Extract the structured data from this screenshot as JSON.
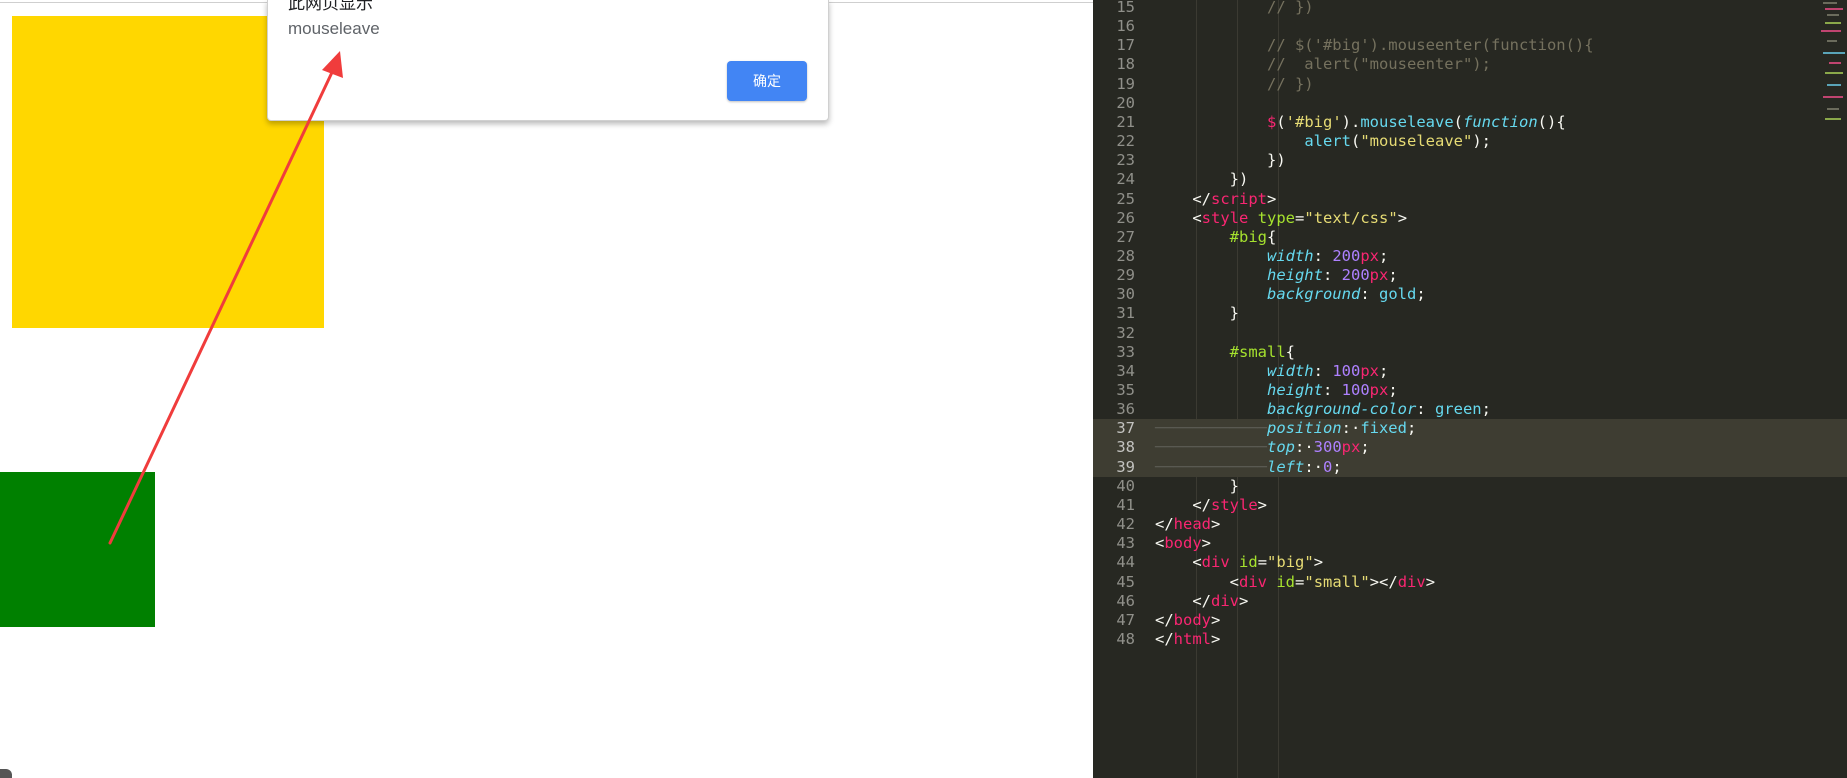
{
  "browser": {
    "dialog": {
      "title": "此网页显示",
      "message": "mouseleave",
      "ok_label": "确定"
    },
    "boxes": {
      "big_color": "#ffd700",
      "small_color": "#008000"
    },
    "arrow_color": "#f03c3c"
  },
  "editor": {
    "theme": {
      "background": "#272822",
      "gutter_text": "#90908a"
    },
    "lines": [
      {
        "n": "15",
        "tokens": [
          [
            "            ",
            "plain"
          ],
          [
            "// })",
            "com"
          ]
        ]
      },
      {
        "n": "16",
        "tokens": []
      },
      {
        "n": "17",
        "tokens": [
          [
            "            ",
            "plain"
          ],
          [
            "// $('#big').mouseenter(function(){",
            "com"
          ]
        ]
      },
      {
        "n": "18",
        "tokens": [
          [
            "            ",
            "plain"
          ],
          [
            "//  alert(\"mouseenter\");",
            "com"
          ]
        ]
      },
      {
        "n": "19",
        "tokens": [
          [
            "            ",
            "plain"
          ],
          [
            "// })",
            "com"
          ]
        ]
      },
      {
        "n": "20",
        "tokens": []
      },
      {
        "n": "21",
        "tokens": [
          [
            "            ",
            "plain"
          ],
          [
            "$",
            "tag"
          ],
          [
            "(",
            "plain"
          ],
          [
            "'#big'",
            "str"
          ],
          [
            ").",
            "plain"
          ],
          [
            "mouseleave",
            "fn"
          ],
          [
            "(",
            "plain"
          ],
          [
            "function",
            "kw"
          ],
          [
            "(){",
            "plain"
          ]
        ]
      },
      {
        "n": "22",
        "tokens": [
          [
            "                ",
            "plain"
          ],
          [
            "alert",
            "fn"
          ],
          [
            "(",
            "plain"
          ],
          [
            "\"mouseleave\"",
            "str"
          ],
          [
            ");",
            "plain"
          ]
        ]
      },
      {
        "n": "23",
        "tokens": [
          [
            "            ",
            "plain"
          ],
          [
            "})",
            "plain"
          ]
        ]
      },
      {
        "n": "24",
        "tokens": [
          [
            "        ",
            "plain"
          ],
          [
            "})",
            "plain"
          ]
        ]
      },
      {
        "n": "25",
        "tokens": [
          [
            "    ",
            "plain"
          ],
          [
            "</",
            "plain"
          ],
          [
            "script",
            "tag"
          ],
          [
            ">",
            "plain"
          ]
        ]
      },
      {
        "n": "26",
        "tokens": [
          [
            "    ",
            "plain"
          ],
          [
            "<",
            "plain"
          ],
          [
            "style",
            "tag"
          ],
          [
            " ",
            "plain"
          ],
          [
            "type",
            "attr"
          ],
          [
            "=",
            "plain"
          ],
          [
            "\"text/css\"",
            "str"
          ],
          [
            ">",
            "plain"
          ]
        ]
      },
      {
        "n": "27",
        "tokens": [
          [
            "        ",
            "plain"
          ],
          [
            "#big",
            "sel"
          ],
          [
            "{",
            "plain"
          ]
        ]
      },
      {
        "n": "28",
        "tokens": [
          [
            "            ",
            "plain"
          ],
          [
            "width",
            "prop"
          ],
          [
            ": ",
            "plain"
          ],
          [
            "200",
            "num"
          ],
          [
            "px",
            "tag"
          ],
          [
            ";",
            "plain"
          ]
        ]
      },
      {
        "n": "29",
        "tokens": [
          [
            "            ",
            "plain"
          ],
          [
            "height",
            "prop"
          ],
          [
            ": ",
            "plain"
          ],
          [
            "200",
            "num"
          ],
          [
            "px",
            "tag"
          ],
          [
            ";",
            "plain"
          ]
        ]
      },
      {
        "n": "30",
        "tokens": [
          [
            "            ",
            "plain"
          ],
          [
            "background",
            "prop"
          ],
          [
            ": ",
            "plain"
          ],
          [
            "gold",
            "val"
          ],
          [
            ";",
            "plain"
          ]
        ]
      },
      {
        "n": "31",
        "tokens": [
          [
            "        ",
            "plain"
          ],
          [
            "}",
            "plain"
          ]
        ]
      },
      {
        "n": "32",
        "tokens": []
      },
      {
        "n": "33",
        "tokens": [
          [
            "        ",
            "plain"
          ],
          [
            "#small",
            "sel"
          ],
          [
            "{",
            "plain"
          ]
        ]
      },
      {
        "n": "34",
        "tokens": [
          [
            "            ",
            "plain"
          ],
          [
            "width",
            "prop"
          ],
          [
            ": ",
            "plain"
          ],
          [
            "100",
            "num"
          ],
          [
            "px",
            "tag"
          ],
          [
            ";",
            "plain"
          ]
        ]
      },
      {
        "n": "35",
        "tokens": [
          [
            "            ",
            "plain"
          ],
          [
            "height",
            "prop"
          ],
          [
            ": ",
            "plain"
          ],
          [
            "100",
            "num"
          ],
          [
            "px",
            "tag"
          ],
          [
            ";",
            "plain"
          ]
        ]
      },
      {
        "n": "36",
        "tokens": [
          [
            "            ",
            "plain"
          ],
          [
            "background-color",
            "prop"
          ],
          [
            ": ",
            "plain"
          ],
          [
            "green",
            "val"
          ],
          [
            ";",
            "plain"
          ]
        ]
      },
      {
        "n": "37",
        "cur": true,
        "tokens": [
          [
            "────────────",
            "ws"
          ],
          [
            "position",
            "prop"
          ],
          [
            ":·",
            "plain"
          ],
          [
            "fixed",
            "val"
          ],
          [
            ";",
            "plain"
          ]
        ]
      },
      {
        "n": "38",
        "cur": true,
        "tokens": [
          [
            "────────────",
            "ws"
          ],
          [
            "top",
            "prop"
          ],
          [
            ":·",
            "plain"
          ],
          [
            "300",
            "num"
          ],
          [
            "px",
            "tag"
          ],
          [
            ";",
            "plain"
          ]
        ]
      },
      {
        "n": "39",
        "cur": true,
        "tokens": [
          [
            "────────────",
            "ws"
          ],
          [
            "left",
            "prop"
          ],
          [
            ":·",
            "plain"
          ],
          [
            "0",
            "num"
          ],
          [
            ";",
            "plain"
          ]
        ]
      },
      {
        "n": "40",
        "tokens": [
          [
            "        ",
            "plain"
          ],
          [
            "}",
            "plain"
          ]
        ]
      },
      {
        "n": "41",
        "tokens": [
          [
            "    ",
            "plain"
          ],
          [
            "</",
            "plain"
          ],
          [
            "style",
            "tag"
          ],
          [
            ">",
            "plain"
          ]
        ]
      },
      {
        "n": "42",
        "tokens": [
          [
            "</",
            "plain"
          ],
          [
            "head",
            "tag"
          ],
          [
            ">",
            "plain"
          ]
        ]
      },
      {
        "n": "43",
        "tokens": [
          [
            "<",
            "plain"
          ],
          [
            "body",
            "tag"
          ],
          [
            ">",
            "plain"
          ]
        ]
      },
      {
        "n": "44",
        "tokens": [
          [
            "    ",
            "plain"
          ],
          [
            "<",
            "plain"
          ],
          [
            "div",
            "tag"
          ],
          [
            " ",
            "plain"
          ],
          [
            "id",
            "attr"
          ],
          [
            "=",
            "plain"
          ],
          [
            "\"big\"",
            "str"
          ],
          [
            ">",
            "plain"
          ]
        ]
      },
      {
        "n": "45",
        "tokens": [
          [
            "        ",
            "plain"
          ],
          [
            "<",
            "plain"
          ],
          [
            "div",
            "tag"
          ],
          [
            " ",
            "plain"
          ],
          [
            "id",
            "attr"
          ],
          [
            "=",
            "plain"
          ],
          [
            "\"small\"",
            "str"
          ],
          [
            "></",
            "plain"
          ],
          [
            "div",
            "tag"
          ],
          [
            ">",
            "plain"
          ]
        ]
      },
      {
        "n": "46",
        "tokens": [
          [
            "    ",
            "plain"
          ],
          [
            "</",
            "plain"
          ],
          [
            "div",
            "tag"
          ],
          [
            ">",
            "plain"
          ]
        ]
      },
      {
        "n": "47",
        "tokens": [
          [
            "</",
            "plain"
          ],
          [
            "body",
            "tag"
          ],
          [
            ">",
            "plain"
          ]
        ]
      },
      {
        "n": "48",
        "tokens": [
          [
            "</",
            "plain"
          ],
          [
            "html",
            "tag"
          ],
          [
            ">",
            "plain"
          ]
        ]
      }
    ]
  }
}
